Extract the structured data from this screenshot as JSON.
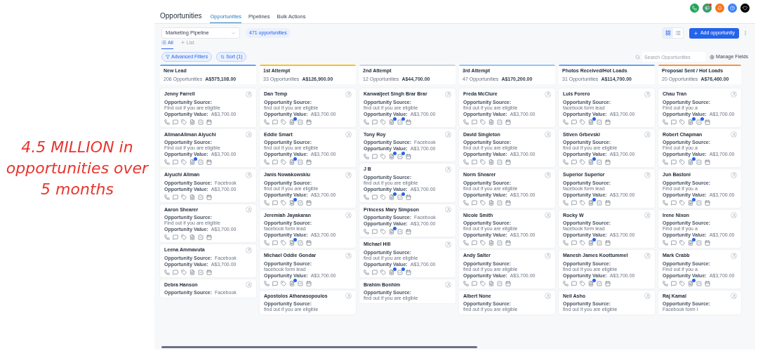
{
  "caption": "4.5 MILLION in opportunities over 5 months",
  "header": {
    "title": "Opportunities",
    "tabs": [
      {
        "label": "Opportunities",
        "selected": true
      },
      {
        "label": "Pipelines",
        "selected": false
      },
      {
        "label": "Bulk Actions",
        "selected": false
      }
    ]
  },
  "toolbar": {
    "pipeline": "Marketing Pipeline",
    "count": "471 opportunities",
    "view_toggles": [
      {
        "kind": "grid",
        "selected": true
      },
      {
        "kind": "list",
        "selected": false
      }
    ],
    "add_button": "Add opportunity"
  },
  "list_tabs": [
    {
      "kind": "all",
      "label": "All",
      "selected": true
    },
    {
      "kind": "add",
      "label": "List",
      "selected": false
    }
  ],
  "filters": {
    "advanced": "Advanced Filters",
    "sort": "Sort (1)",
    "search_placeholder": "Search Opportunities",
    "manage": "Manage Fields"
  },
  "stages": [
    {
      "name": "New Lead",
      "count": "206 Opportunities",
      "total": "A$575,108.00",
      "color": "#60a5fa",
      "cards": [
        {
          "name": "Jenny Farrell",
          "source_label": "Opportunity Source:",
          "source": "Find out if you are eligible",
          "value_label": "Opportunity Value:",
          "value": "A$3,700.00",
          "note_badge": false,
          "task_badge": false
        },
        {
          "name": "AlimanAliman Aiyuchi",
          "source_label": "Opportunity Source:",
          "source": "Find out if you are eligible",
          "value_label": "Opportunity Value:",
          "value": "A$3,700.00",
          "note_badge": true,
          "task_badge": false
        },
        {
          "name": "Aiyuchi Aliman",
          "source_label": "Opportunity Source:",
          "source": "Facebook",
          "value_label": "Opportunity Value:",
          "value": "A$3,700.00",
          "note_badge": false,
          "task_badge": false
        },
        {
          "name": "Aaron Shearer",
          "source_label": "Opportunity Source:",
          "source": "Find out if you are eligible",
          "value_label": "Opportunity Value:",
          "value": "A$3,700.00",
          "note_badge": false,
          "task_badge": false
        },
        {
          "name": "Leena Ammavuta",
          "source_label": "Opportunity Source:",
          "source": "Facebook",
          "value_label": "Opportunity Value:",
          "value": "A$3,700.00",
          "note_badge": false,
          "task_badge": false
        },
        {
          "name": "Debra Hanson",
          "source_label": "Opportunity Source:",
          "source": "Facebook"
        }
      ]
    },
    {
      "name": "1st Attempt",
      "count": "33 Opportunities",
      "total": "A$126,900.00",
      "color": "#fbbf24",
      "cards": [
        {
          "name": "Dan Temp",
          "source_label": "Opportunity Source:",
          "source": "find out if you are eligible",
          "value_label": "Opportunity Value:",
          "value": "A$3,700.00",
          "note_badge": true,
          "task_badge": false
        },
        {
          "name": "Eddie Smart",
          "source_label": "Opportunity Source:",
          "source": "find out if you are eligible",
          "value_label": "Opportunity Value:",
          "value": "A$3,700.00",
          "note_badge": true,
          "task_badge": false
        },
        {
          "name": "Janis Nowakowskiu",
          "source_label": "Opportunity Source:",
          "source": "find out if you are eligible",
          "value_label": "Opportunity Value:",
          "value": "A$3,700.00",
          "note_badge": true,
          "task_badge": false
        },
        {
          "name": "Jeremiah Jayakaran",
          "source_label": "Opportunity Source:",
          "source": "facebook form lead",
          "value_label": "Opportunity Value:",
          "value": "A$3,700.00",
          "note_badge": true,
          "task_badge": false
        },
        {
          "name": "Michael Oddie Gondar",
          "source_label": "Opportunity Source:",
          "source": "facebook form lead",
          "value_label": "Opportunity Value:",
          "value": "A$3,700.00",
          "note_badge": true,
          "task_badge": false
        },
        {
          "name": "Apostolos Athanasopoulos",
          "source_label": "Opportunity Source:",
          "source": "find out if you are eligible"
        }
      ]
    },
    {
      "name": "2nd Attempt",
      "count": "12 Opportunities",
      "total": "A$44,700.00",
      "color": "#cbd5e1",
      "cards": [
        {
          "name": "Kanwaljeet Singh Brar Brar",
          "source_label": "Opportunity Source:",
          "source": "find out if you are eligible",
          "value_label": "Opportunity Value:",
          "value": "A$3,700.00",
          "note_badge": true,
          "task_badge": true
        },
        {
          "name": "Tony Roy",
          "source_label": "Opportunity Source:",
          "source": "Facebook",
          "value_label": "Opportunity Value:",
          "value": "A$3,700.00",
          "note_badge": true,
          "task_badge": true
        },
        {
          "name": "J B",
          "source_label": "Opportunity Source:",
          "source": "find out if you are eligible",
          "value_label": "Opportunity Value:",
          "value": "A$3,700.00",
          "note_badge": true,
          "task_badge": true
        },
        {
          "name": "Princess Mary Simpson",
          "source_label": "Opportunity Source:",
          "source": "Facebook",
          "value_label": "Opportunity Value:",
          "value": "A$3,700.00",
          "note_badge": true,
          "task_badge": false
        },
        {
          "name": "Michael Hill",
          "source_label": "Opportunity Source:",
          "source": "find out if you are eligible",
          "value_label": "Opportunity Value:",
          "value": "A$3,700.00",
          "note_badge": true,
          "task_badge": true
        },
        {
          "name": "Brahim Bonhim",
          "source_label": "Opportunity Source:",
          "source": "find out if you are eligible"
        }
      ]
    },
    {
      "name": "3rd Attempt",
      "count": "47 Opportunities",
      "total": "A$170,200.00",
      "color": "#93c5fd",
      "cards": [
        {
          "name": "Freda McClure",
          "source_label": "Opportunity Source:",
          "source": "find out if you are eligible",
          "value_label": "Opportunity Value:",
          "value": "A$3,700.00",
          "note_badge": false,
          "task_badge": false
        },
        {
          "name": "David Singleton",
          "source_label": "Opportunity Source:",
          "source": "find out if you are eligible",
          "value_label": "Opportunity Value:",
          "value": "A$3,700.00",
          "note_badge": false,
          "task_badge": false
        },
        {
          "name": "Norm Shearer",
          "source_label": "Opportunity Source:",
          "source": "find out if you are eligible",
          "value_label": "Opportunity Value:",
          "value": "A$3,700.00",
          "note_badge": false,
          "task_badge": false
        },
        {
          "name": "Nicole Smith",
          "source_label": "Opportunity Source:",
          "source": "find out if you are eligible",
          "value_label": "Opportunity Value:",
          "value": "A$3,700.00",
          "note_badge": false,
          "task_badge": false
        },
        {
          "name": "Andy Salter",
          "source_label": "Opportunity Source:",
          "source": "find out if you are eligible",
          "value_label": "Opportunity Value:",
          "value": "A$3,700.00",
          "note_badge": false,
          "task_badge": false
        },
        {
          "name": "Albert None",
          "source_label": "Opportunity Source:",
          "source": "find out if you are eligible"
        }
      ]
    },
    {
      "name": "Photos Received/Hot Loads",
      "count": "31 Opportunities",
      "total": "A$114,700.00",
      "color": "#60a5fa",
      "cards": [
        {
          "name": "Luis Forero",
          "source_label": "Opportunity Source:",
          "source": "facebook form lead",
          "value_label": "Opportunity Value:",
          "value": "A$3,700.00",
          "note_badge": true,
          "task_badge": false
        },
        {
          "name": "Stiven Grbevski",
          "source_label": "Opportunity Source:",
          "source": "find out if you are eligible",
          "value_label": "Opportunity Value:",
          "value": "A$3,700.00",
          "note_badge": true,
          "task_badge": false
        },
        {
          "name": "Superior Superior",
          "source_label": "Opportunity Source:",
          "source": "facebook form lead",
          "value_label": "Opportunity Value:",
          "value": "A$3,700.00",
          "note_badge": true,
          "task_badge": false
        },
        {
          "name": "Rocky W",
          "source_label": "Opportunity Source:",
          "source": "facebook form lead",
          "value_label": "Opportunity Value:",
          "value": "A$3,700.00",
          "note_badge": true,
          "task_badge": false
        },
        {
          "name": "Manesh James Koottummel",
          "source_label": "Opportunity Source:",
          "source": "find out if you are eligible",
          "value_label": "Opportunity Value:",
          "value": "A$3,700.00",
          "note_badge": true,
          "task_badge": false
        },
        {
          "name": "Neil Asho",
          "source_label": "Opportunity Source:",
          "source": "find out if you are eligible"
        }
      ]
    },
    {
      "name": "Proposal Sent / Hot Loads",
      "count": "20 Opportunities",
      "total": "A$76,460.00",
      "color": "#fb923c",
      "cards": [
        {
          "name": "Chau Tran",
          "source_label": "Opportunity Source:",
          "source": "Find out if you a",
          "value_label": "Opportunity Value:",
          "value": "A$3,700.00",
          "note_badge": true,
          "task_badge": true
        },
        {
          "name": "Robert Chapman",
          "source_label": "Opportunity Source:",
          "source": "Find out if you a",
          "value_label": "Opportunity Value:",
          "value": "A$3,700.00",
          "note_badge": true,
          "task_badge": false
        },
        {
          "name": "Jun Bastoni",
          "source_label": "Opportunity Source:",
          "source": "Find out if you a",
          "value_label": "Opportunity Value:",
          "value": "A$3,700.00",
          "note_badge": true,
          "task_badge": false
        },
        {
          "name": "Irene Nixon",
          "source_label": "Opportunity Source:",
          "source": "Find out if you a",
          "value_label": "Opportunity Value:",
          "value": "A$3,700.00",
          "note_badge": true,
          "task_badge": false
        },
        {
          "name": "Mark Crabb",
          "source_label": "Opportunity Source:",
          "source": "Find out if you a",
          "value_label": "Opportunity Value:",
          "value": "A$3,700.00",
          "note_badge": true,
          "task_badge": false
        },
        {
          "name": "Raj Kamal",
          "source_label": "Opportunity Source:",
          "source": "Facebook form l"
        }
      ]
    }
  ]
}
